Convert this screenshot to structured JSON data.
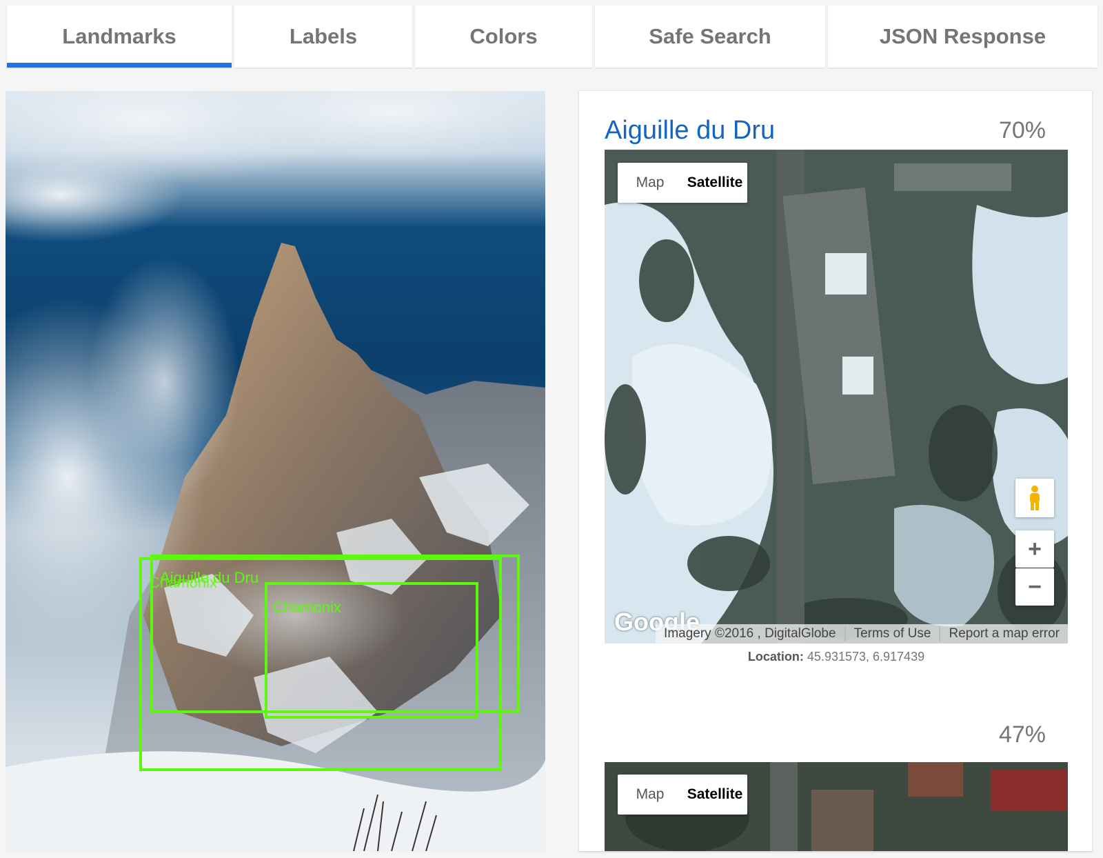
{
  "tabs": [
    {
      "label": "Landmarks",
      "active": true
    },
    {
      "label": "Labels",
      "active": false
    },
    {
      "label": "Colors",
      "active": false
    },
    {
      "label": "Safe Search",
      "active": false
    },
    {
      "label": "JSON Response",
      "active": false
    }
  ],
  "photo": {
    "annotations": [
      {
        "label": "Aiguille du Dru"
      },
      {
        "label": "Chamonix"
      },
      {
        "label": "Chamonix"
      }
    ]
  },
  "results": [
    {
      "name": "Aiguille du Dru",
      "score": "70%",
      "map": {
        "map_label": "Map",
        "satellite_label": "Satellite",
        "selected": "Satellite",
        "logo": "Google",
        "imagery": "Imagery ©2016 , DigitalGlobe",
        "terms": "Terms of Use",
        "report": "Report a map error",
        "pegman_icon": "pegman-icon",
        "zoom_in": "+",
        "zoom_out": "−"
      },
      "location_label": "Location:",
      "location_value": "45.931573, 6.917439"
    },
    {
      "name": "",
      "score": "47%",
      "map": {
        "map_label": "Map",
        "satellite_label": "Satellite",
        "selected": "Satellite"
      }
    }
  ],
  "colors": {
    "accent": "#1a73e8",
    "bbox": "#5ef80e",
    "title": "#1565c0"
  }
}
